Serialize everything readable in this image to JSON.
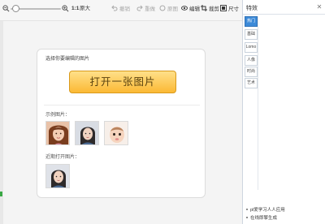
{
  "toolbar": {
    "zoom_ratio": "1:1",
    "actual_size_label": "原大",
    "undo_label": "撤销",
    "redo_label": "重做",
    "reset_label": "原图",
    "edit_label": "编辑",
    "crop_label": "裁剪",
    "size_label": "尺寸"
  },
  "card": {
    "title": "选择你要编辑的图片",
    "open_button": "打开一张图片",
    "samples_label": "示例图片：",
    "recent_label": "近期打开图片："
  },
  "panel": {
    "title": "特效",
    "tabs": [
      "热门",
      "基础",
      "Lomo",
      "人像",
      "时尚",
      "艺术"
    ],
    "active_tab": "热门",
    "hints": [
      "pl爱学习人人应用",
      "在线即擎生成"
    ]
  },
  "colors": {
    "accent": "#3c8ad8",
    "button_top": "#ffe08a",
    "button_bottom": "#fbb934"
  }
}
